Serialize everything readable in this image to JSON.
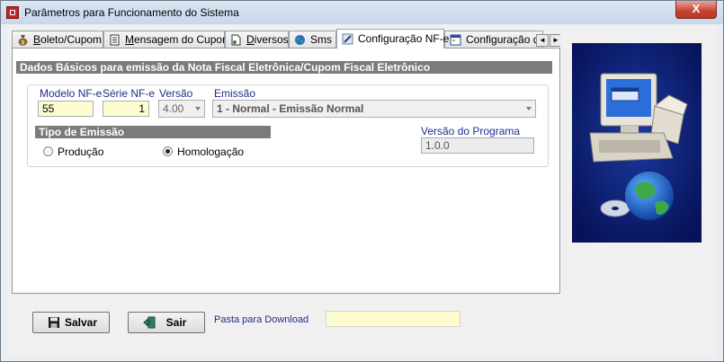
{
  "window": {
    "title": "Parâmetros para Funcionamento do Sistema",
    "close_label": "X"
  },
  "tabs": [
    {
      "label": "Boleto/Cupom",
      "underline": "B",
      "rest": "oleto/Cupom",
      "icon": "money-bag-icon"
    },
    {
      "label": "Mensagem do Cupom",
      "underline": "M",
      "rest": "ensagem do Cupom",
      "icon": "document-icon"
    },
    {
      "label": "Diversos",
      "underline": "D",
      "rest": "iversos",
      "icon": "page-icon"
    },
    {
      "label": "Sms",
      "underline": "",
      "rest": "Sms",
      "icon": "globe-icon"
    },
    {
      "label": "Configuração NF-e",
      "underline": "",
      "rest": "Configuração NF-e",
      "icon": "pencil-icon",
      "active": true
    },
    {
      "label": "Configuração de",
      "underline": "",
      "rest": "Configuração de",
      "icon": "form-icon"
    }
  ],
  "tab_scroll": {
    "left": "◄",
    "right": "►"
  },
  "panel": {
    "section_title": "Dados Básicos para emissão da Nota Fiscal Eletrônica/Cupom Fiscal Eletrônico",
    "modelo_label": "Modelo NF-e",
    "modelo_value": "55",
    "serie_label": "Série NF-e",
    "serie_value": "1",
    "versao_label": "Versão",
    "versao_value": "4.00",
    "emissao_label": "Emissão",
    "emissao_value": "1 - Normal - Emissão Normal",
    "tipo_emissao_title": "Tipo de Emissão",
    "radio_producao": "Produção",
    "radio_homologacao": "Homologação",
    "selected_radio": "Homologação",
    "versao_programa_label": "Versão do Programa",
    "versao_programa_value": "1.0.0"
  },
  "bottom": {
    "salvar_label": "Salvar",
    "sair_label": "Sair",
    "download_label": "Pasta para Download",
    "download_value": ""
  }
}
